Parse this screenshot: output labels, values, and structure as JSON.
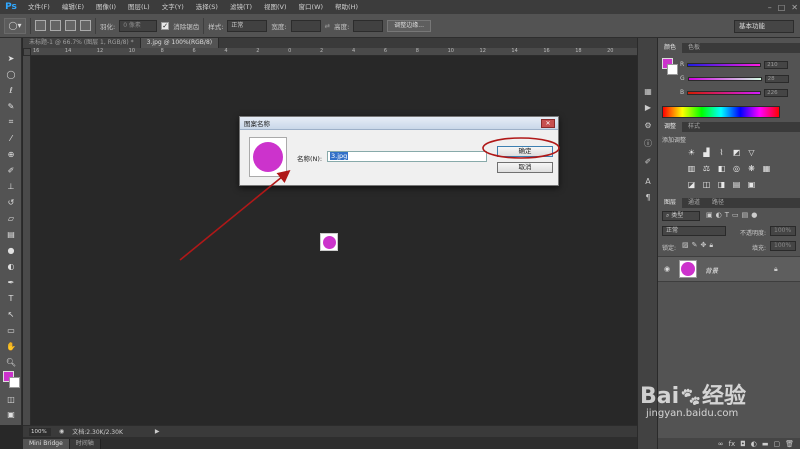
{
  "app": {
    "logo": "Ps",
    "menus": [
      "文件(F)",
      "编辑(E)",
      "图像(I)",
      "图层(L)",
      "文字(Y)",
      "选择(S)",
      "滤镜(T)",
      "视图(V)",
      "窗口(W)",
      "帮助(H)"
    ],
    "window_controls": [
      "–",
      "□",
      "✕"
    ]
  },
  "options_bar": {
    "feather_label": "羽化:",
    "feather_value": "0 像素",
    "antialias_label": "消除锯齿",
    "style_label": "样式:",
    "style_value": "正常",
    "width_label": "宽度:",
    "height_label": "高度:",
    "refine_edge_button": "调整边缘...",
    "workspace": "基本功能"
  },
  "doc_tabs": [
    {
      "label": "未标题-1 @ 66.7% (图层 1, RGB/8) *",
      "active": false
    },
    {
      "label": "3.jpg @ 100%(RGB/8)",
      "active": true
    }
  ],
  "ruler_labels": [
    "16",
    "14",
    "12",
    "10",
    "8",
    "6",
    "4",
    "2",
    "0",
    "2",
    "4",
    "6",
    "8",
    "10",
    "12",
    "14",
    "16",
    "18",
    "20"
  ],
  "colors": {
    "foreground": "#cc33cc",
    "background": "#ffffff",
    "accent_purple": "#cc33cc",
    "annotation_red": "#b01818"
  },
  "status": {
    "zoom": "100%",
    "doc_info": "文档:2.30K/2.30K"
  },
  "bottom_tabs": [
    "Mini Bridge",
    "时间轴"
  ],
  "color_panel": {
    "tabs": [
      "颜色",
      "色板"
    ],
    "channels": [
      {
        "label": "R",
        "value": "210"
      },
      {
        "label": "G",
        "value": "28"
      },
      {
        "label": "B",
        "value": "226"
      }
    ]
  },
  "adjustments_panel": {
    "tabs": [
      "调整",
      "样式"
    ],
    "subtitle": "添加调整"
  },
  "layers_panel": {
    "tabs": [
      "图层",
      "通道",
      "路径"
    ],
    "filter_label": "类型",
    "blend_mode": "正常",
    "opacity_label": "不透明度:",
    "opacity_value": "100%",
    "lock_label": "锁定:",
    "fill_label": "填充:",
    "fill_value": "100%",
    "layer_name": "背景"
  },
  "dialog": {
    "title": "图案名称",
    "name_label": "名称(N):",
    "name_value": "3.jpg",
    "ok_button": "确定",
    "cancel_button": "取消"
  },
  "watermark": {
    "brand": "Bai",
    "brand_suffix": "经验",
    "url": "jingyan.baidu.com"
  }
}
